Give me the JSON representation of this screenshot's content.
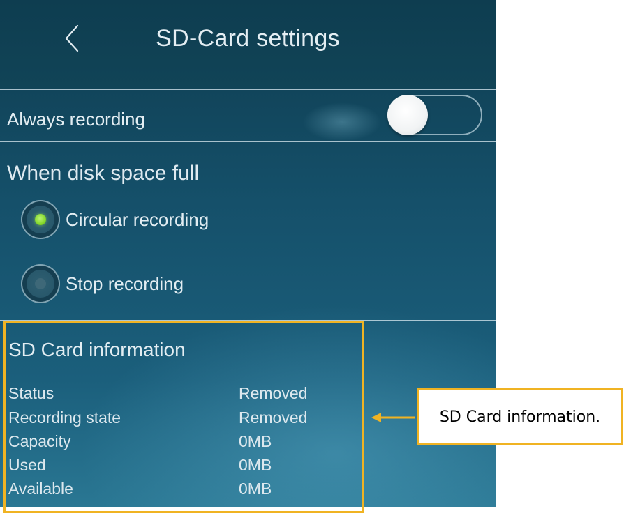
{
  "header": {
    "title": "SD-Card settings",
    "back_icon": "chevron-left-icon"
  },
  "always_recording": {
    "label": "Always recording",
    "enabled": false
  },
  "disk_full": {
    "title": "When disk space full",
    "options": [
      {
        "label": "Circular recording",
        "selected": true
      },
      {
        "label": "Stop recording",
        "selected": false
      }
    ]
  },
  "sd_info": {
    "title": "SD Card information",
    "rows": [
      {
        "key": "Status",
        "value": "Removed"
      },
      {
        "key": "Recording state",
        "value": "Removed"
      },
      {
        "key": "Capacity",
        "value": "0MB"
      },
      {
        "key": "Used",
        "value": "0MB"
      },
      {
        "key": "Available",
        "value": "0MB"
      }
    ]
  },
  "annotation": {
    "callout_text": "SD Card information.",
    "highlight_color": "#f0b323"
  },
  "colors": {
    "background_top": "#0e3c4f",
    "background_bottom": "#2a7793",
    "radio_active": "#7ed321",
    "text": "#e2edf2"
  }
}
